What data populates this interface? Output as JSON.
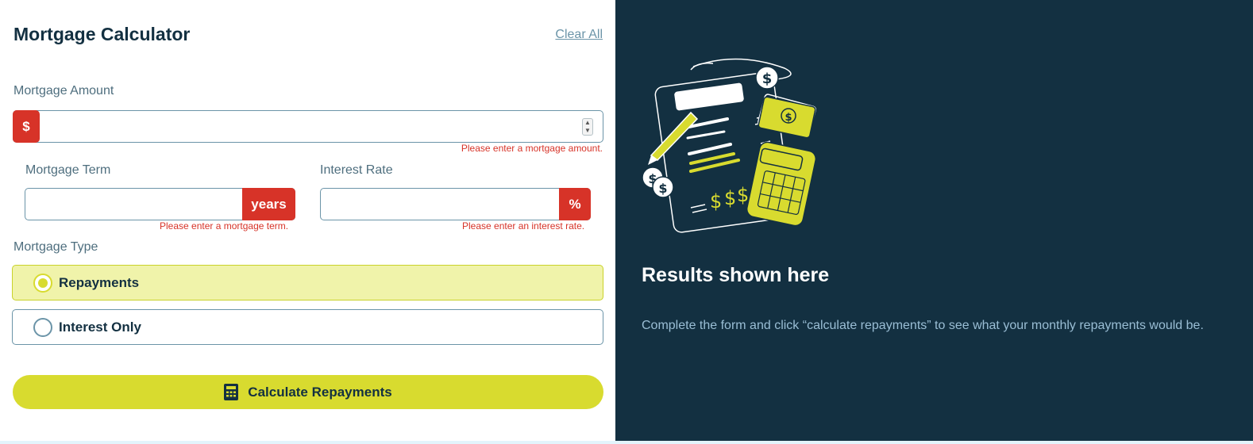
{
  "form": {
    "title": "Mortgage Calculator",
    "clear_all": "Clear All",
    "amount": {
      "label": "Mortgage Amount",
      "prefix": "$",
      "value": "",
      "error": "Please enter a mortgage amount."
    },
    "term": {
      "label": "Mortgage Term",
      "suffix": "years",
      "value": "",
      "error": "Please enter a mortgage term."
    },
    "rate": {
      "label": "Interest Rate",
      "suffix": "%",
      "value": "",
      "error": "Please enter an interest rate."
    },
    "type": {
      "label": "Mortgage Type",
      "options": [
        {
          "label": "Repayments",
          "selected": true
        },
        {
          "label": "Interest Only",
          "selected": false
        }
      ]
    },
    "submit_label": "Calculate Repayments"
  },
  "results": {
    "title": "Results shown here",
    "description": "Complete the form and click “calculate repayments” to see what your monthly repayments would be."
  },
  "colors": {
    "accent": "#d8db2f",
    "error": "#d73328",
    "dark": "#133041"
  },
  "icons": {
    "calculator": "calculator-icon",
    "illustration": "empty-results-illustration"
  }
}
